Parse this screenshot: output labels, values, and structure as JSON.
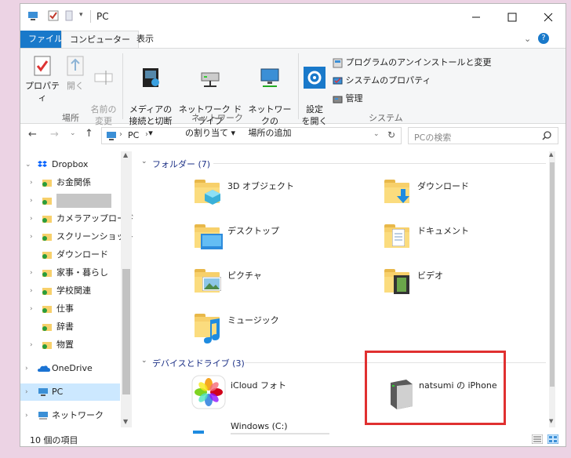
{
  "window": {
    "title": "PC",
    "controls": [
      "minimize",
      "maximize",
      "close"
    ]
  },
  "ribbon": {
    "tabs": [
      "ファイル",
      "コンピューター",
      "表示"
    ],
    "groups": [
      {
        "label": "場所",
        "buttons": [
          {
            "label": "プロパティ",
            "icon": "properties-icon"
          },
          {
            "label": "開く",
            "icon": "open-icon",
            "disabled": true
          },
          {
            "label": "名前の\n変更",
            "icon": "rename-icon",
            "disabled": true
          }
        ]
      },
      {
        "label": "ネットワーク",
        "buttons": [
          {
            "label": "メディアの\n接続と切断 ▾",
            "icon": "media-icon"
          },
          {
            "label": "ネットワーク ドライブ\nの割り当て ▾",
            "icon": "network-drive-icon"
          },
          {
            "label": "ネットワークの\n場所の追加",
            "icon": "network-location-icon"
          }
        ]
      },
      {
        "label": "システム",
        "buttons": [
          {
            "label": "設定\nを開く",
            "icon": "settings-icon"
          },
          {
            "label": "プログラムのアンインストールと変更",
            "icon": "uninstall-icon"
          },
          {
            "label": "システムのプロパティ",
            "icon": "system-properties-icon"
          },
          {
            "label": "管理",
            "icon": "manage-icon"
          }
        ]
      }
    ]
  },
  "address": {
    "path": [
      "PC"
    ],
    "search_placeholder": "PCの検索"
  },
  "nav": {
    "items": [
      {
        "label": "Dropbox",
        "level": 0,
        "expanded": true
      },
      {
        "label": "お金関係",
        "level": 1
      },
      {
        "label": "",
        "level": 1,
        "redacted": true
      },
      {
        "label": "カメラアップロード",
        "level": 1
      },
      {
        "label": "スクリーンショット",
        "level": 1
      },
      {
        "label": "ダウンロード",
        "level": 1,
        "no_chevron": true
      },
      {
        "label": "家事・暮らし",
        "level": 1
      },
      {
        "label": "学校関連",
        "level": 1
      },
      {
        "label": "仕事",
        "level": 1
      },
      {
        "label": "辞書",
        "level": 1,
        "no_chevron": true
      },
      {
        "label": "物置",
        "level": 1
      },
      {
        "label": "OneDrive",
        "level": 0
      },
      {
        "label": "PC",
        "level": 0,
        "selected": true
      },
      {
        "label": "ネットワーク",
        "level": 0
      }
    ]
  },
  "content": {
    "folders_header": "フォルダー (7)",
    "folders": [
      "3D オブジェクト",
      "ダウンロード",
      "デスクトップ",
      "ドキュメント",
      "ピクチャ",
      "ビデオ",
      "ミュージック"
    ],
    "devices_header": "デバイスとドライブ (3)",
    "devices": [
      "iCloud フォト",
      "natsumi の iPhone",
      "Windows (C:)"
    ]
  },
  "status": {
    "count": "10 個の項目"
  }
}
